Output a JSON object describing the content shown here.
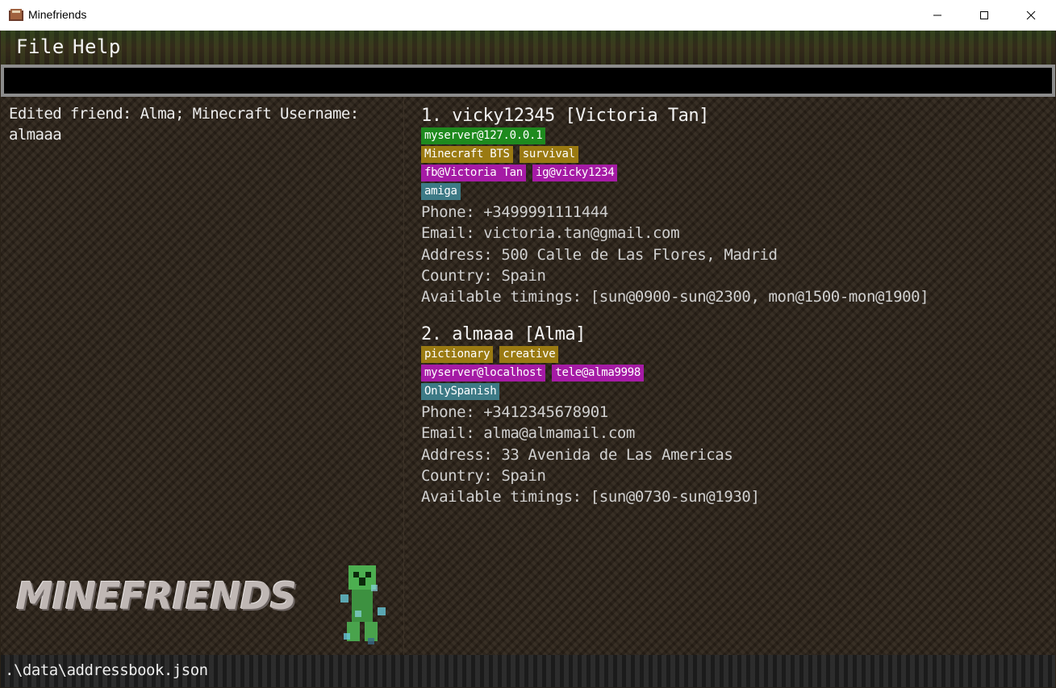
{
  "window": {
    "title": "Minefriends"
  },
  "menu": {
    "file": "File",
    "help": "Help"
  },
  "command": {
    "value": "",
    "placeholder": ""
  },
  "result": {
    "message": "Edited friend: Alma; Minecraft Username: almaaa"
  },
  "logo": {
    "text": "MINEFRIENDS"
  },
  "friends": [
    {
      "index_name": "1. vicky12345 [Victoria Tan]",
      "tag_rows": [
        [
          {
            "label": "myserver@127.0.0.1",
            "color": "#1e8a1e"
          }
        ],
        [
          {
            "label": "Minecraft BTS",
            "color": "#9a7a12"
          },
          {
            "label": "survival",
            "color": "#9a7a12"
          }
        ],
        [
          {
            "label": "fb@Victoria Tan",
            "color": "#a51ba5"
          },
          {
            "label": "ig@vicky1234",
            "color": "#a51ba5"
          }
        ],
        [
          {
            "label": "amiga",
            "color": "#3d7a86"
          }
        ]
      ],
      "phone": "Phone: +3499991111444",
      "email": "Email: victoria.tan@gmail.com",
      "address": "Address: 500 Calle de Las Flores, Madrid",
      "country": "Country: Spain",
      "timings": "Available timings: [sun@0900-sun@2300, mon@1500-mon@1900]"
    },
    {
      "index_name": "2. almaaa [Alma]",
      "tag_rows": [
        [
          {
            "label": "pictionary",
            "color": "#9a7a12"
          },
          {
            "label": "creative",
            "color": "#9a7a12"
          }
        ],
        [
          {
            "label": "myserver@localhost",
            "color": "#a51ba5"
          },
          {
            "label": "tele@alma9998",
            "color": "#a51ba5"
          }
        ],
        [
          {
            "label": "OnlySpanish",
            "color": "#3d7a86"
          }
        ]
      ],
      "phone": "Phone: +3412345678901",
      "email": "Email: alma@almamail.com",
      "address": "Address: 33 Avenida de Las Americas",
      "country": "Country: Spain",
      "timings": "Available timings: [sun@0730-sun@1930]"
    }
  ],
  "status": {
    "file_path": ".\\data\\addressbook.json"
  }
}
